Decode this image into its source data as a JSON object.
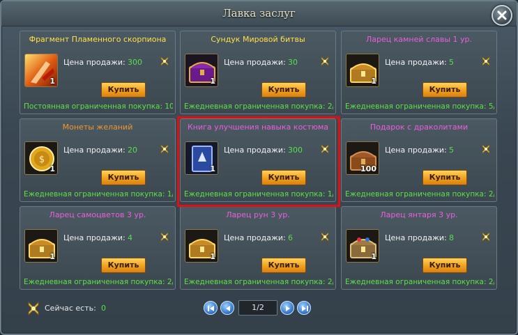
{
  "window": {
    "title": "Лавка заслуг"
  },
  "items": [
    {
      "name": "Фрагмент Пламенного скорпиона",
      "name_color": "#ffe04a",
      "icon": "scorpion-fragment-icon",
      "qty": "1",
      "price_label": "Цена продажи:",
      "price": "300",
      "buy_label": "Купить",
      "limit": "Постоянная ограниченная покупка: 10,"
    },
    {
      "name": "Сундук Мировой битвы",
      "name_color": "#ffe04a",
      "icon": "purple-chest-icon",
      "qty": "1",
      "price_label": "Цена продажи:",
      "price": "30",
      "buy_label": "Купить",
      "limit": "Ежедневная ограниченная покупка: 2/"
    },
    {
      "name": "Ларец камней славы 1 ур.",
      "name_color": "#e860d8",
      "icon": "gold-chest-icon",
      "qty": "1",
      "price_label": "Цена продажи:",
      "price": "5",
      "buy_label": "Купить",
      "limit": "Ежедневная ограниченная покупка: 5/"
    },
    {
      "name": "Монеты желаний",
      "name_color": "#f0952c",
      "icon": "gold-coin-icon",
      "qty": "1",
      "price_label": "Цена продажи:",
      "price": "20",
      "buy_label": "Купить",
      "limit": "Ежедневная ограниченная покупка: 1/"
    },
    {
      "name": "Книга улучшения навыка костюма",
      "name_color": "#e860d8",
      "icon": "blue-book-icon",
      "qty": "1",
      "price_label": "Цена продажи:",
      "price": "300",
      "buy_label": "Купить",
      "limit": "Ежедневная ограниченная покупка: 1/"
    },
    {
      "name": "Подарок с драколитами",
      "name_color": "#e860d8",
      "icon": "wooden-chest-icon",
      "qty": "100",
      "price_label": "Цена продажи:",
      "price": "5",
      "buy_label": "Купить",
      "limit": "Ежедневная ограниченная покупка: 2/"
    },
    {
      "name": "Ларец самоцветов 3 ур.",
      "name_color": "#e860d8",
      "icon": "gold-chest-icon",
      "qty": "1",
      "price_label": "Цена продажи:",
      "price": "4",
      "buy_label": "Купить",
      "limit": "Ежедневная ограниченная покупка: 2/"
    },
    {
      "name": "Ларец рун 3 ур.",
      "name_color": "#e860d8",
      "icon": "gold-chest-icon",
      "qty": "1",
      "price_label": "Цена продажи:",
      "price": "6",
      "buy_label": "Купить",
      "limit": "Ежедневная ограниченная покупка: 2/"
    },
    {
      "name": "Ларец янтаря 3 ур.",
      "name_color": "#e860d8",
      "icon": "gem-chest-icon",
      "qty": "1",
      "price_label": "Цена продажи:",
      "price": "8",
      "buy_label": "Купить",
      "limit": "Ежедневная ограниченная покупка: 2/"
    }
  ],
  "footer": {
    "currency_icon": "merit-medal-icon",
    "label": "Сейчас есть:",
    "value": "0",
    "page": "1/2"
  }
}
